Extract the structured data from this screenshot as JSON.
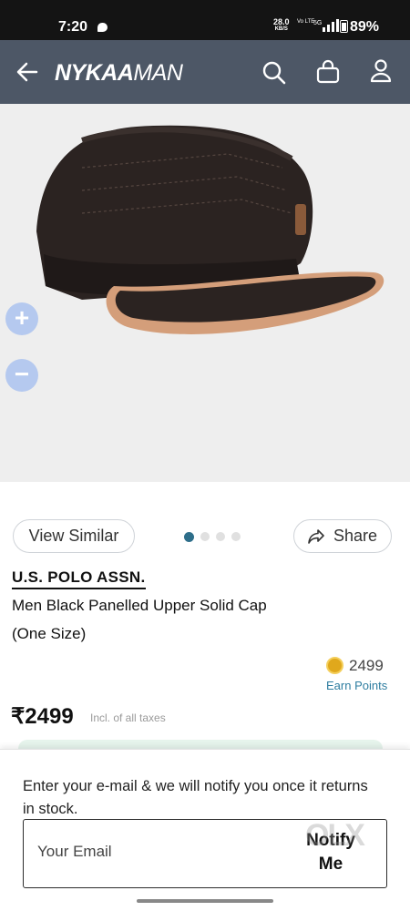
{
  "status_bar": {
    "time": "7:20",
    "net_speed": "28.0",
    "net_speed_unit": "KB/S",
    "volte": "Vo LTE",
    "network": "5G",
    "battery": "89%"
  },
  "header": {
    "brand_prefix": "NYKAA",
    "brand_suffix": "MAN",
    "icons": [
      "back-arrow-icon",
      "search-icon",
      "shopping-bag-icon",
      "account-icon"
    ],
    "background_color": "#4d5766"
  },
  "gallery": {
    "zoom_in_label": "+",
    "zoom_out_label": "−",
    "total_images": 4,
    "active_image_index": 0
  },
  "actions": {
    "view_similar": "View Similar",
    "share": "Share"
  },
  "product": {
    "brand": "U.S. POLO ASSN.",
    "title": "Men Black Panelled Upper Solid Cap",
    "size": "(One Size)",
    "points": "2499",
    "points_label": "Earn Points",
    "price": "₹2499",
    "price_note": "Incl. of all taxes"
  },
  "notify_sheet": {
    "message": "Enter your e-mail & we will notify you once it returns in stock.",
    "email_placeholder": "Your Email",
    "email_value": "",
    "notify_button": "Notify Me"
  },
  "watermark": "OLX",
  "colors": {
    "accent_blue": "#2e7da0",
    "coin_gold": "#e0a81c",
    "zoom_button": "#b5c9ef"
  }
}
